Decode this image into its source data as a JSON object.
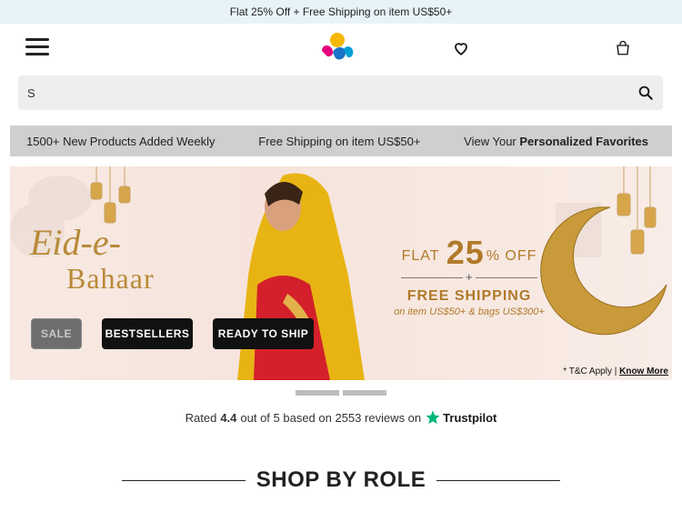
{
  "promo": {
    "text": "Flat 25% Off + Free Shipping on item US$50+"
  },
  "search": {
    "value": "S"
  },
  "usp": {
    "item1": "1500+ New Products Added Weekly",
    "item2": "Free Shipping on item US$50+",
    "item3_prefix": "View Your ",
    "item3_bold": "Personalized Favorites"
  },
  "banner": {
    "title_line1": "Eid-e-",
    "title_line2": "Bahaar",
    "offer_flat": "FLAT",
    "offer_percent": "25",
    "offer_off": "% OFF",
    "offer_plus": "+",
    "offer_shipping": "FREE SHIPPING",
    "offer_condition": "on item US$50+ & bags US$300+",
    "buttons": {
      "sale": "SALE",
      "bestsellers": "BESTSELLERS",
      "ready": "READY TO SHIP"
    },
    "tc_prefix": "* T&C Apply | ",
    "tc_link": "Know More"
  },
  "rating": {
    "prefix": "Rated",
    "score": "4.4",
    "middle": "out of 5 based on 2553 reviews on",
    "brand": "Trustpilot"
  },
  "section": {
    "title": "SHOP BY ROLE"
  },
  "colors": {
    "gold": "#b07a2a",
    "trustpilot_green": "#00b67a",
    "promo_bg": "#e8f3f8"
  }
}
